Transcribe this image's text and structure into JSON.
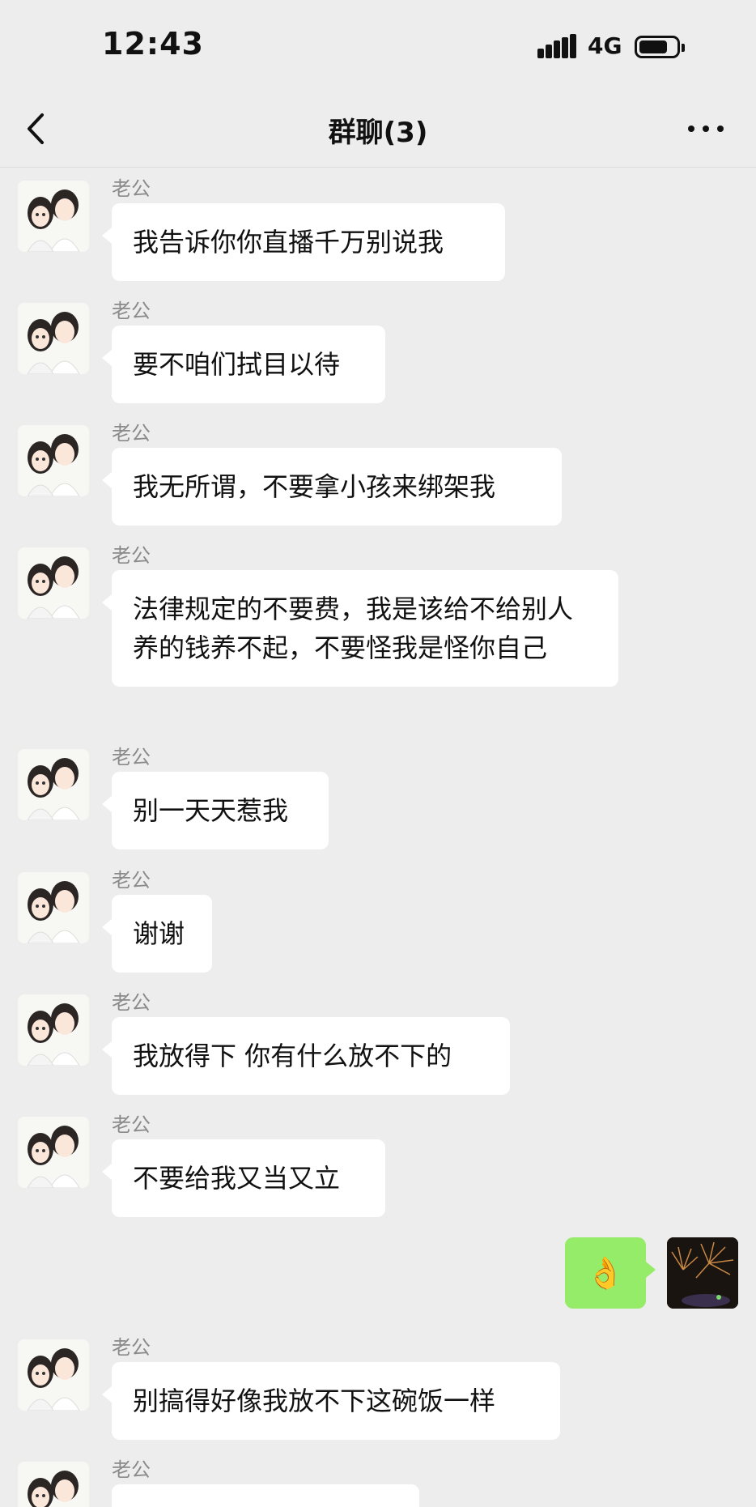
{
  "status_bar": {
    "time": "12:43",
    "network": "4G",
    "signal_icon": "signal-bars-icon",
    "battery_icon": "battery-icon"
  },
  "nav": {
    "back_icon": "chevron-left-icon",
    "title": "群聊(3)",
    "more_icon": "more-horizontal-icon"
  },
  "colors": {
    "background": "#ededed",
    "incoming_bubble": "#ffffff",
    "outgoing_bubble": "#95ec69",
    "sender_name": "#8a8a8a"
  },
  "messages": [
    {
      "sender": "老公",
      "text": "我告诉你你直播千万别说我"
    },
    {
      "sender": "老公",
      "text": "要不咱们拭目以待"
    },
    {
      "sender": "老公",
      "text": "我无所谓，不要拿小孩来绑架我"
    },
    {
      "sender": "老公",
      "text": "法律规定的不要费，我是该给不给别人养的钱养不起，不要怪我是怪你自己"
    },
    {
      "sender": "老公",
      "text": "别一天天惹我"
    },
    {
      "sender": "老公",
      "text": "谢谢"
    },
    {
      "sender": "老公",
      "text": "我放得下 你有什么放不下的"
    },
    {
      "sender": "老公",
      "text": "不要给我又当又立"
    }
  ],
  "my_message": {
    "emoji": "👌",
    "avatar_icon": "fireworks-avatar-icon"
  },
  "messages_after": [
    {
      "sender": "老公",
      "text": "别搞得好像我放不下这碗饭一样"
    },
    {
      "sender": "老公",
      "text": ""
    }
  ]
}
